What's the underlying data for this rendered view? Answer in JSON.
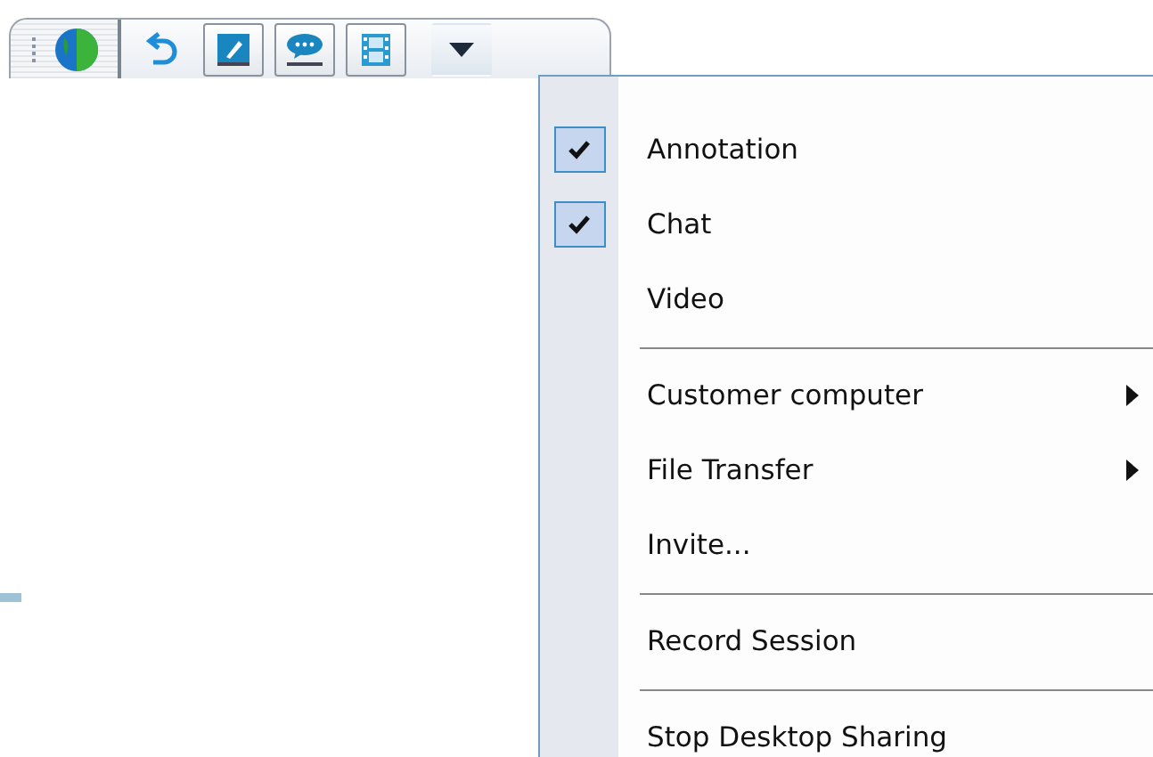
{
  "toolbar": {
    "buttons": [
      {
        "kind": "globe",
        "pressed": false
      },
      {
        "kind": "undo",
        "pressed": false
      },
      {
        "kind": "annotation",
        "pressed": true
      },
      {
        "kind": "chat",
        "pressed": true
      },
      {
        "kind": "video",
        "pressed": true
      },
      {
        "kind": "dropdown",
        "pressed": false
      }
    ]
  },
  "menu": {
    "items": [
      {
        "kind": "check",
        "label": "Annotation",
        "checked": true
      },
      {
        "kind": "check",
        "label": "Chat",
        "checked": true
      },
      {
        "kind": "check",
        "label": "Video",
        "checked": false
      },
      {
        "kind": "separator"
      },
      {
        "kind": "submenu",
        "label": "Customer computer"
      },
      {
        "kind": "submenu",
        "label": "File Transfer"
      },
      {
        "kind": "action",
        "label": "Invite..."
      },
      {
        "kind": "separator"
      },
      {
        "kind": "action",
        "label": "Record Session"
      },
      {
        "kind": "separator"
      },
      {
        "kind": "action",
        "label": "Stop Desktop Sharing"
      }
    ]
  }
}
